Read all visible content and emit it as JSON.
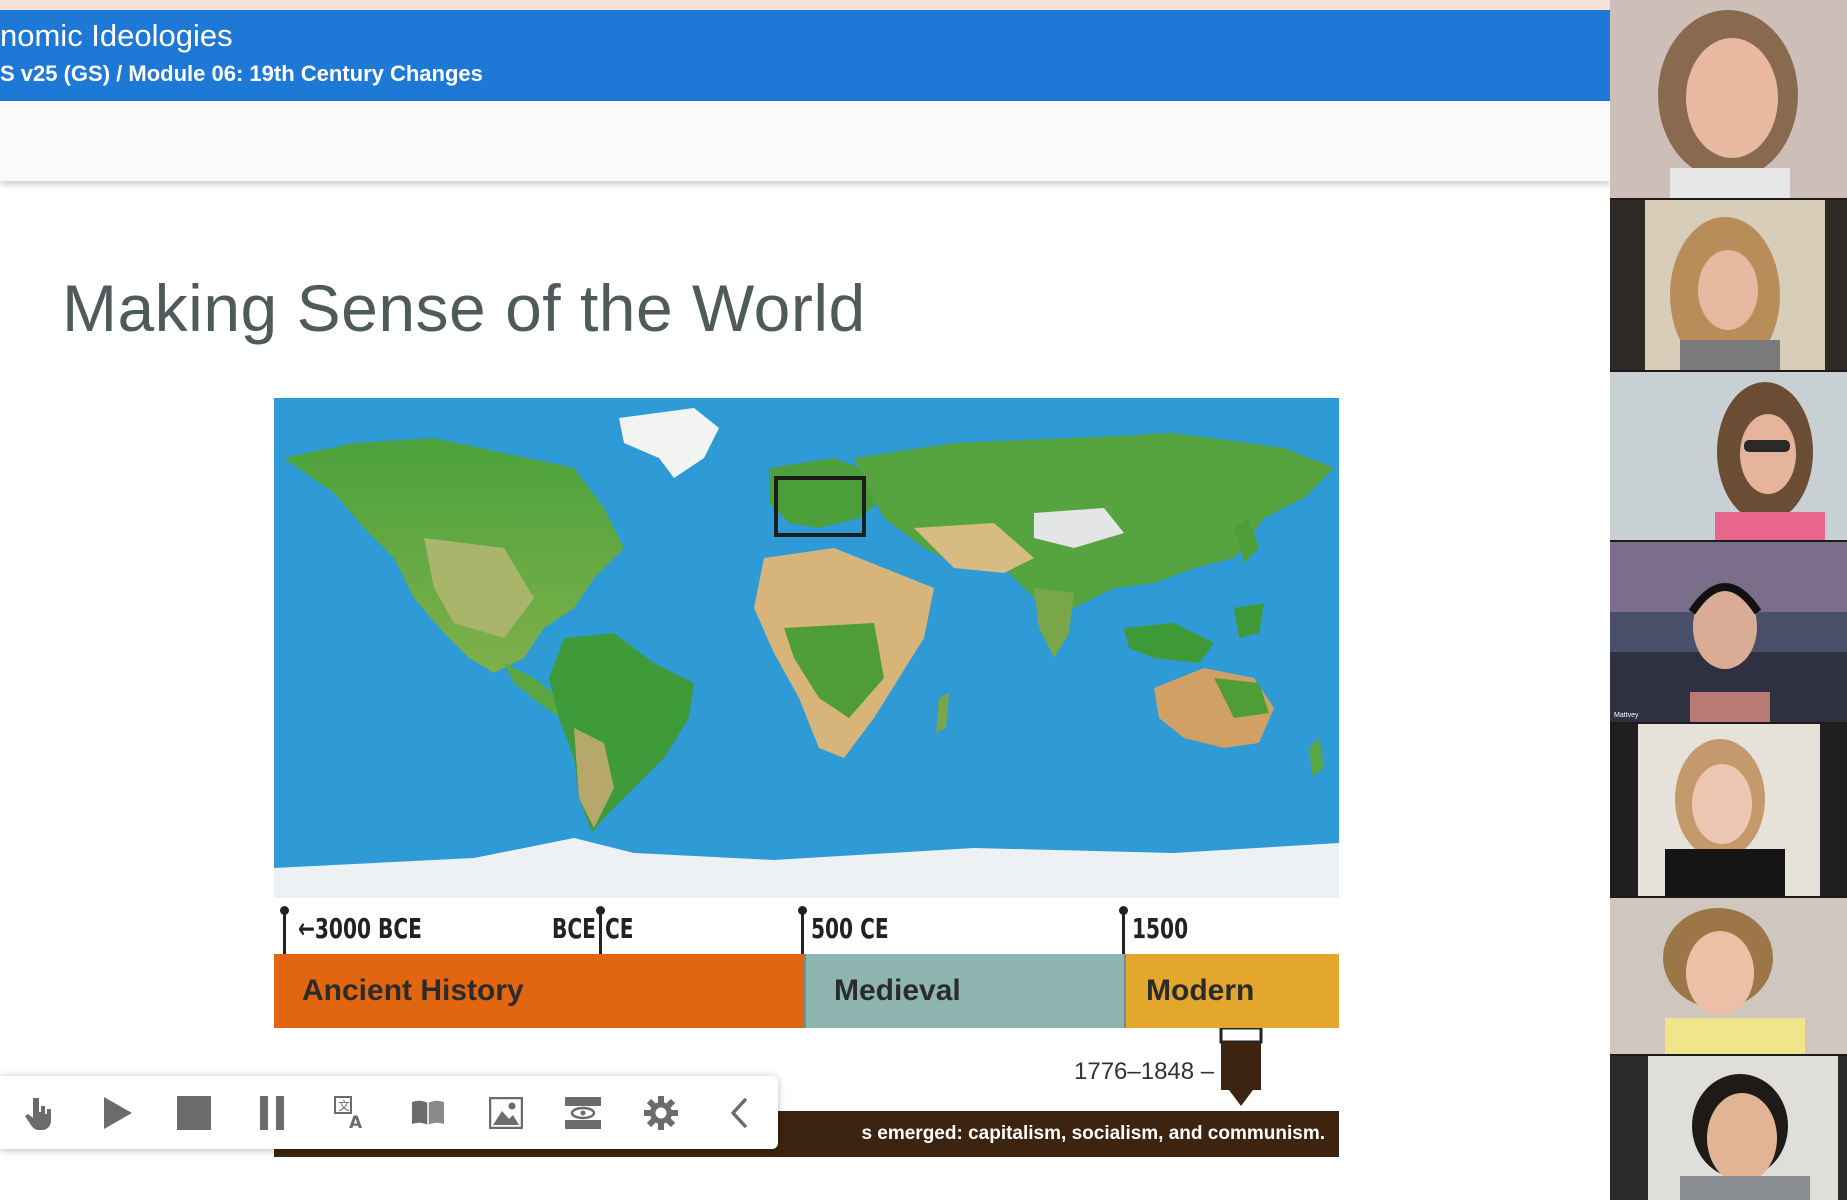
{
  "header": {
    "course_title": "nomic Ideologies",
    "breadcrumb": "S v25 (GS) / Module 06: 19th Century Changes"
  },
  "slide": {
    "title": "Making Sense of the World",
    "timeline": {
      "ticks": [
        "3000 BCE",
        "BCE",
        "CE",
        "500 CE",
        "1500"
      ],
      "eras": [
        {
          "label": "Ancient History",
          "color": "#e1660f"
        },
        {
          "label": "Medieval",
          "color": "#8fb5b0"
        },
        {
          "label": "Modern",
          "color": "#e2a72c"
        }
      ],
      "highlight_range": "1776–1848"
    },
    "caption": "s emerged: capitalism, socialism, and communism."
  },
  "toolbar": {
    "buttons": [
      {
        "icon": "hand-pointer-icon",
        "label": "Click to speak"
      },
      {
        "icon": "play-icon",
        "label": "Play"
      },
      {
        "icon": "stop-icon",
        "label": "Stop"
      },
      {
        "icon": "pause-icon",
        "label": "Pause"
      },
      {
        "icon": "translate-icon",
        "label": "Translate"
      },
      {
        "icon": "dictionary-icon",
        "label": "Dictionary"
      },
      {
        "icon": "picture-dictionary-icon",
        "label": "Picture dictionary"
      },
      {
        "icon": "screen-mask-icon",
        "label": "Screen mask"
      },
      {
        "icon": "gear-icon",
        "label": "Settings"
      },
      {
        "icon": "chevron-left-icon",
        "label": "Collapse"
      }
    ]
  },
  "participants": {
    "count": 7,
    "name_4": "Mattvey"
  },
  "colors": {
    "header_blue": "#1e78d6",
    "ocean": "#2f9bd6",
    "caption_brown": "#3c2410"
  }
}
